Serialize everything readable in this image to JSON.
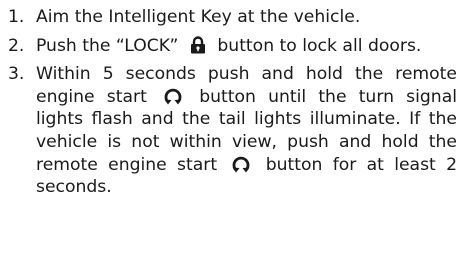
{
  "steps": [
    {
      "number": "1.",
      "text": "Aim the Intelligent Key at the vehicle."
    },
    {
      "number": "2.",
      "text_before": "Push the “LOCK”",
      "icon": "padlock-icon",
      "text_after": "button to lock all doors."
    },
    {
      "number": "3.",
      "text_part1": "Within 5 seconds push and hold the remote engine start",
      "icon": "remote-start-icon",
      "text_part2": "button until the turn signal lights flash and the tail lights illuminate. If the vehicle is not within view, push and hold the remote engine start",
      "text_part3": "button for at least 2 seconds."
    }
  ]
}
